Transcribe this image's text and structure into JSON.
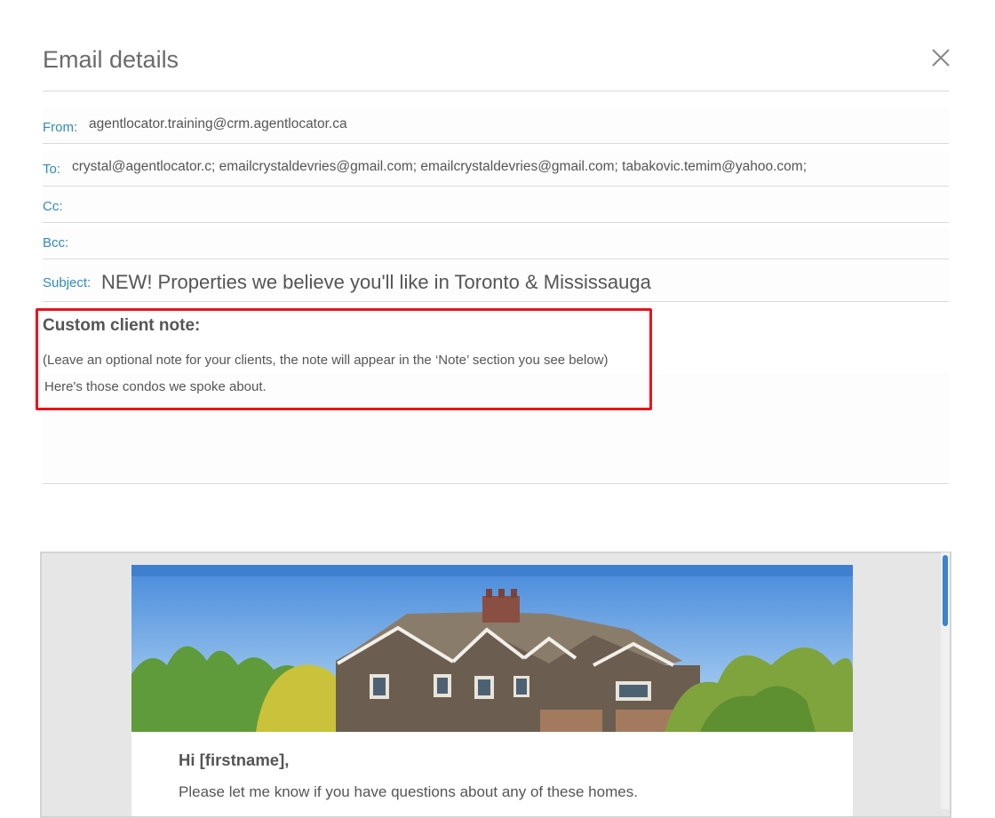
{
  "dialog": {
    "title": "Email details"
  },
  "fields": {
    "from_label": "From:",
    "from_value": "agentlocator.training@crm.agentlocator.ca",
    "to_label": "To:",
    "to_value": "crystal@agentlocator.c; emailcrystaldevries@gmail.com; emailcrystaldevries@gmail.com; tabakovic.temim@yahoo.com;",
    "cc_label": "Cc:",
    "cc_value": "",
    "bcc_label": "Bcc:",
    "bcc_value": "",
    "subject_label": "Subject:",
    "subject_value": "NEW! Properties we believe you'll like in Toronto & Mississauga"
  },
  "note": {
    "heading": "Custom client note:",
    "help": "(Leave an optional note for your clients, the note will appear in the ‘Note’ section you see below)",
    "text": " Here's those condos we spoke about."
  },
  "preview": {
    "greeting": "Hi [firstname],",
    "body": "Please let me know if you have questions about any of these homes."
  },
  "colors": {
    "label": "#2e8bc0",
    "highlight": "#e8141c",
    "email_bar": "#3f7fcf",
    "scroll_thumb": "#3c86c8"
  },
  "icons": {
    "close": "close-icon"
  }
}
